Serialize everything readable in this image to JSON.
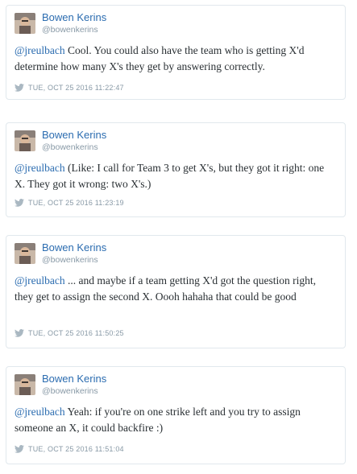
{
  "tweets": [
    {
      "author": "Bowen Kerins",
      "handle": "@bowenkerins",
      "mention": "@jreulbach",
      "text": " Cool. You could also have the team who is getting X'd determine how many X's they get by answering correctly.",
      "timestamp": "TUE, OCT 25 2016 11:22:47"
    },
    {
      "author": "Bowen Kerins",
      "handle": "@bowenkerins",
      "mention": "@jreulbach",
      "text": " (Like: I call for Team 3 to get X's, but they got it right: one X. They got it wrong: two X's.)",
      "timestamp": "TUE, OCT 25 2016 11:23:19"
    },
    {
      "author": "Bowen Kerins",
      "handle": "@bowenkerins",
      "mention": "@jreulbach",
      "text": " ... and maybe if a team getting X'd got the question right, they get to assign the second X. Oooh hahaha that could be good",
      "timestamp": "TUE, OCT 25 2016 11:50:25"
    },
    {
      "author": "Bowen Kerins",
      "handle": "@bowenkerins",
      "mention": "@jreulbach",
      "text": " Yeah: if you're on one strike left and you try to assign someone an X, it could backfire :)",
      "timestamp": "TUE, OCT 25 2016 11:51:04"
    }
  ],
  "colors": {
    "link": "#2b6cb0",
    "muted": "#8899a6",
    "border": "#e1e8ed",
    "text": "#292f33"
  },
  "icons": {
    "meta_icon": "twitter-bird-icon",
    "avatar": "profile-photo"
  }
}
